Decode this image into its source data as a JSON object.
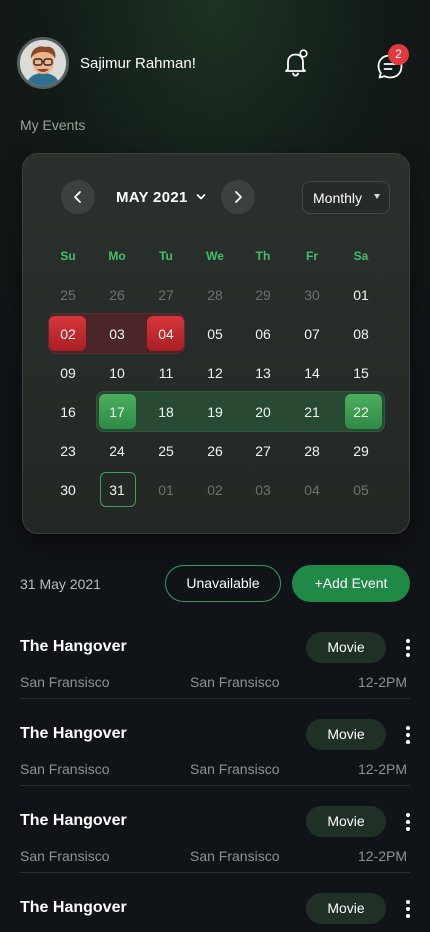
{
  "header": {
    "username": "Sajimur Rahman!",
    "notification_badge": "2"
  },
  "section_title": "My Events",
  "calendar": {
    "month_label": "MAY 2021",
    "view": "Monthly",
    "weekdays": [
      "Su",
      "Mo",
      "Tu",
      "We",
      "Th",
      "Fr",
      "Sa"
    ],
    "weeks": [
      [
        "25",
        "26",
        "27",
        "28",
        "29",
        "30",
        "01"
      ],
      [
        "02",
        "03",
        "04",
        "05",
        "06",
        "07",
        "08"
      ],
      [
        "09",
        "10",
        "11",
        "12",
        "13",
        "14",
        "15"
      ],
      [
        "16",
        "17",
        "18",
        "19",
        "20",
        "21",
        "22"
      ],
      [
        "23",
        "24",
        "25",
        "26",
        "27",
        "28",
        "29"
      ],
      [
        "30",
        "31",
        "01",
        "02",
        "03",
        "04",
        "05"
      ]
    ],
    "unavailable_range": [
      "02",
      "04"
    ],
    "event_range": [
      "17",
      "22"
    ],
    "selected_day": "31"
  },
  "actions": {
    "selected_date": "31 May 2021",
    "unavailable_label": "Unavailable",
    "add_event_label": "+Add Event"
  },
  "events": [
    {
      "title": "The Hangover",
      "tag": "Movie",
      "from": "San Fransisco",
      "to": "San Fransisco",
      "time": "12-2PM"
    },
    {
      "title": "The Hangover",
      "tag": "Movie",
      "from": "San Fransisco",
      "to": "San Fransisco",
      "time": "12-2PM"
    },
    {
      "title": "The Hangover",
      "tag": "Movie",
      "from": "San Fransisco",
      "to": "San Fransisco",
      "time": "12-2PM"
    },
    {
      "title": "The Hangover",
      "tag": "Movie"
    }
  ],
  "colors": {
    "accent_green": "#1f8a45",
    "unavailable_red": "#d6363b",
    "weekday_green": "#41c06b",
    "badge_red": "#e0393e"
  }
}
